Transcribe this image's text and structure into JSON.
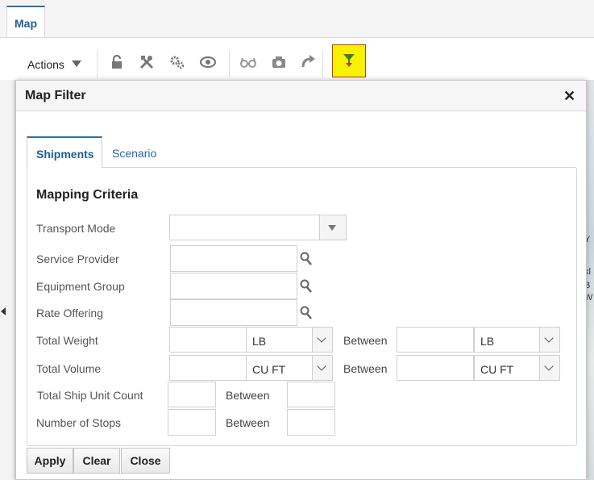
{
  "top_tab": {
    "label": "Map"
  },
  "toolbar": {
    "actions_label": "Actions",
    "icons": [
      "lock-icon",
      "tools-icon",
      "gears-icon",
      "eye-icon",
      "glasses-icon",
      "camera-icon",
      "redo-icon",
      "filter-icon"
    ],
    "highlight_color": "#f7f300"
  },
  "map_snippets": [
    "t",
    "Y",
    "kl",
    "B",
    "W"
  ],
  "dialog": {
    "title": "Map Filter",
    "close_glyph": "✕",
    "tabs": [
      {
        "label": "Shipments",
        "active": true
      },
      {
        "label": "Scenario",
        "active": false
      }
    ],
    "section_title": "Mapping Criteria",
    "fields": {
      "transport_mode": {
        "label": "Transport Mode",
        "value": ""
      },
      "service_provider": {
        "label": "Service Provider",
        "value": ""
      },
      "equipment_group": {
        "label": "Equipment Group",
        "value": ""
      },
      "rate_offering": {
        "label": "Rate Offering",
        "value": ""
      },
      "total_weight": {
        "label": "Total Weight",
        "from": "",
        "unit_from": "LB",
        "between": "Between",
        "to": "",
        "unit_to": "LB"
      },
      "total_volume": {
        "label": "Total Volume",
        "from": "",
        "unit_from": "CU FT",
        "between": "Between",
        "to": "",
        "unit_to": "CU FT"
      },
      "total_ship_unit_count": {
        "label": "Total Ship Unit Count",
        "from": "",
        "between": "Between",
        "to": ""
      },
      "number_of_stops": {
        "label": "Number of Stops",
        "from": "",
        "between": "Between",
        "to": ""
      }
    },
    "buttons": {
      "apply": "Apply",
      "clear": "Clear",
      "close": "Close"
    }
  },
  "colors": {
    "accent": "#1f5f8f",
    "link": "#2266aa"
  }
}
